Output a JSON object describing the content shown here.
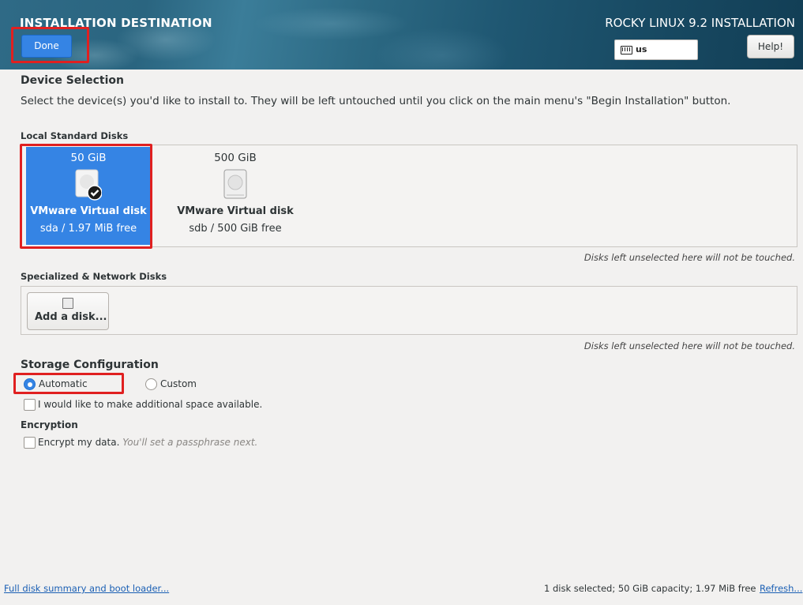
{
  "header": {
    "title": "INSTALLATION DESTINATION",
    "product": "ROCKY LINUX 9.2 INSTALLATION",
    "done_label": "Done",
    "keyboard_layout": "us",
    "help_label": "Help!"
  },
  "device_selection": {
    "heading": "Device Selection",
    "description": "Select the device(s) you'd like to install to.  They will be left untouched until you click on the main menu's \"Begin Installation\" button.",
    "local_heading": "Local Standard Disks",
    "disks": [
      {
        "size": "50 GiB",
        "name": "VMware Virtual disk",
        "detail": "sda  /  1.97 MiB free",
        "selected": true
      },
      {
        "size": "500 GiB",
        "name": "VMware Virtual disk",
        "detail": "sdb  /  500 GiB free",
        "selected": false
      }
    ],
    "local_note": "Disks left unselected here will not be touched.",
    "specialized_heading": "Specialized & Network Disks",
    "add_disk_label": "Add a disk...",
    "specialized_note": "Disks left unselected here will not be touched."
  },
  "storage": {
    "heading": "Storage Configuration",
    "options": [
      {
        "label": "Automatic",
        "selected": true
      },
      {
        "label": "Custom",
        "selected": false
      }
    ],
    "reclaim_label": "I would like to make additional space available.",
    "encryption_heading": "Encryption",
    "encrypt_label": "Encrypt my data.",
    "encrypt_hint": "You'll set a passphrase next."
  },
  "footer": {
    "summary_link": "Full disk summary and boot loader...",
    "status": "1 disk selected; 50 GiB capacity; 1.97 MiB free",
    "refresh_link": "Refresh..."
  },
  "colors": {
    "accent": "#3584e4",
    "highlight": "#e02020",
    "link": "#1a5fb4"
  }
}
